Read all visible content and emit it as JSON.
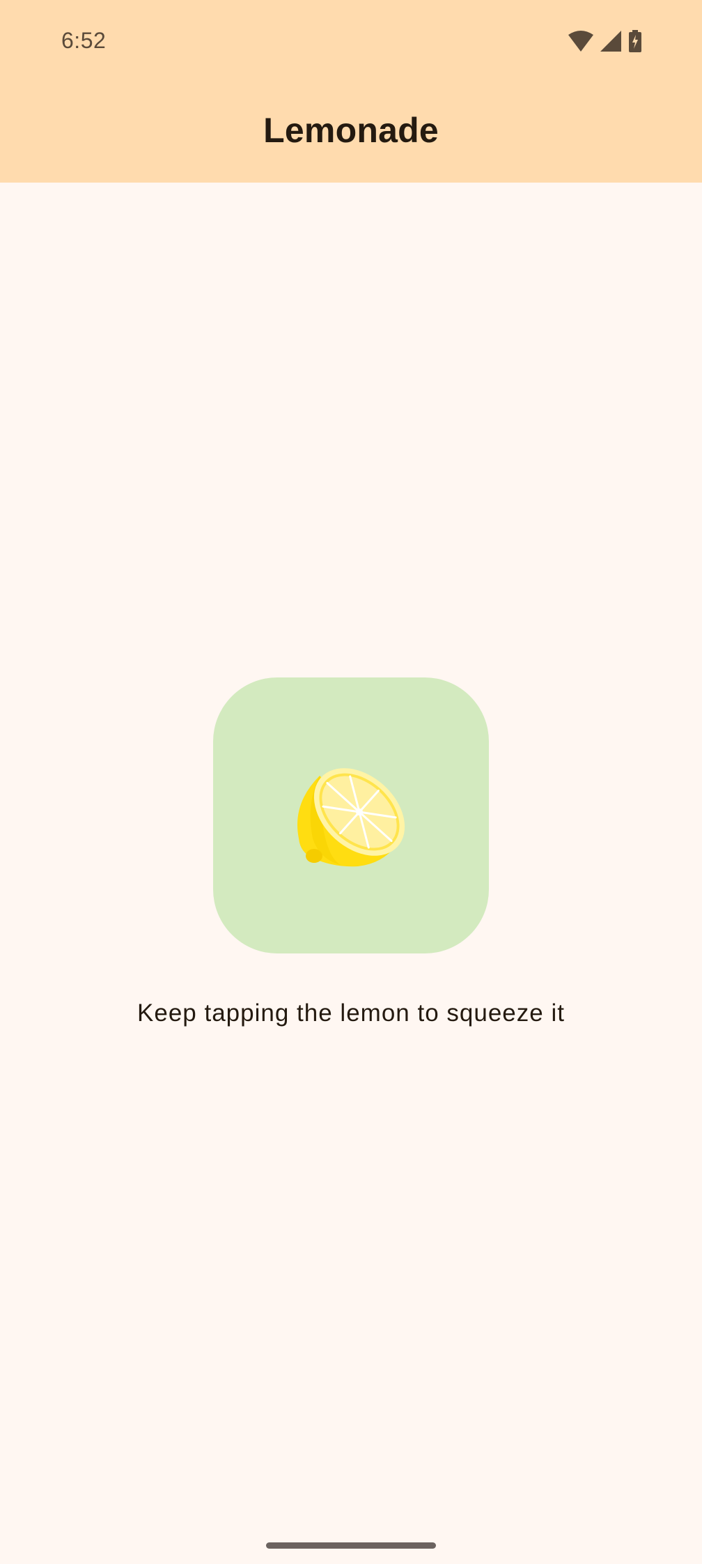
{
  "status_bar": {
    "time": "6:52",
    "icons": [
      "wifi-icon",
      "cellular-signal-icon",
      "battery-charging-icon"
    ]
  },
  "top_app_bar": {
    "title": "Lemonade"
  },
  "lemon_button": {
    "image": "lemon-half-icon"
  },
  "instruction": {
    "text": "Keep tapping the lemon to squeeze it"
  },
  "colors": {
    "top_bar_bg": "#FFDBAE",
    "background": "#FFF7F2",
    "button_bg": "#D3EABF",
    "lemon": "#FFDD11",
    "text": "#241A10"
  }
}
